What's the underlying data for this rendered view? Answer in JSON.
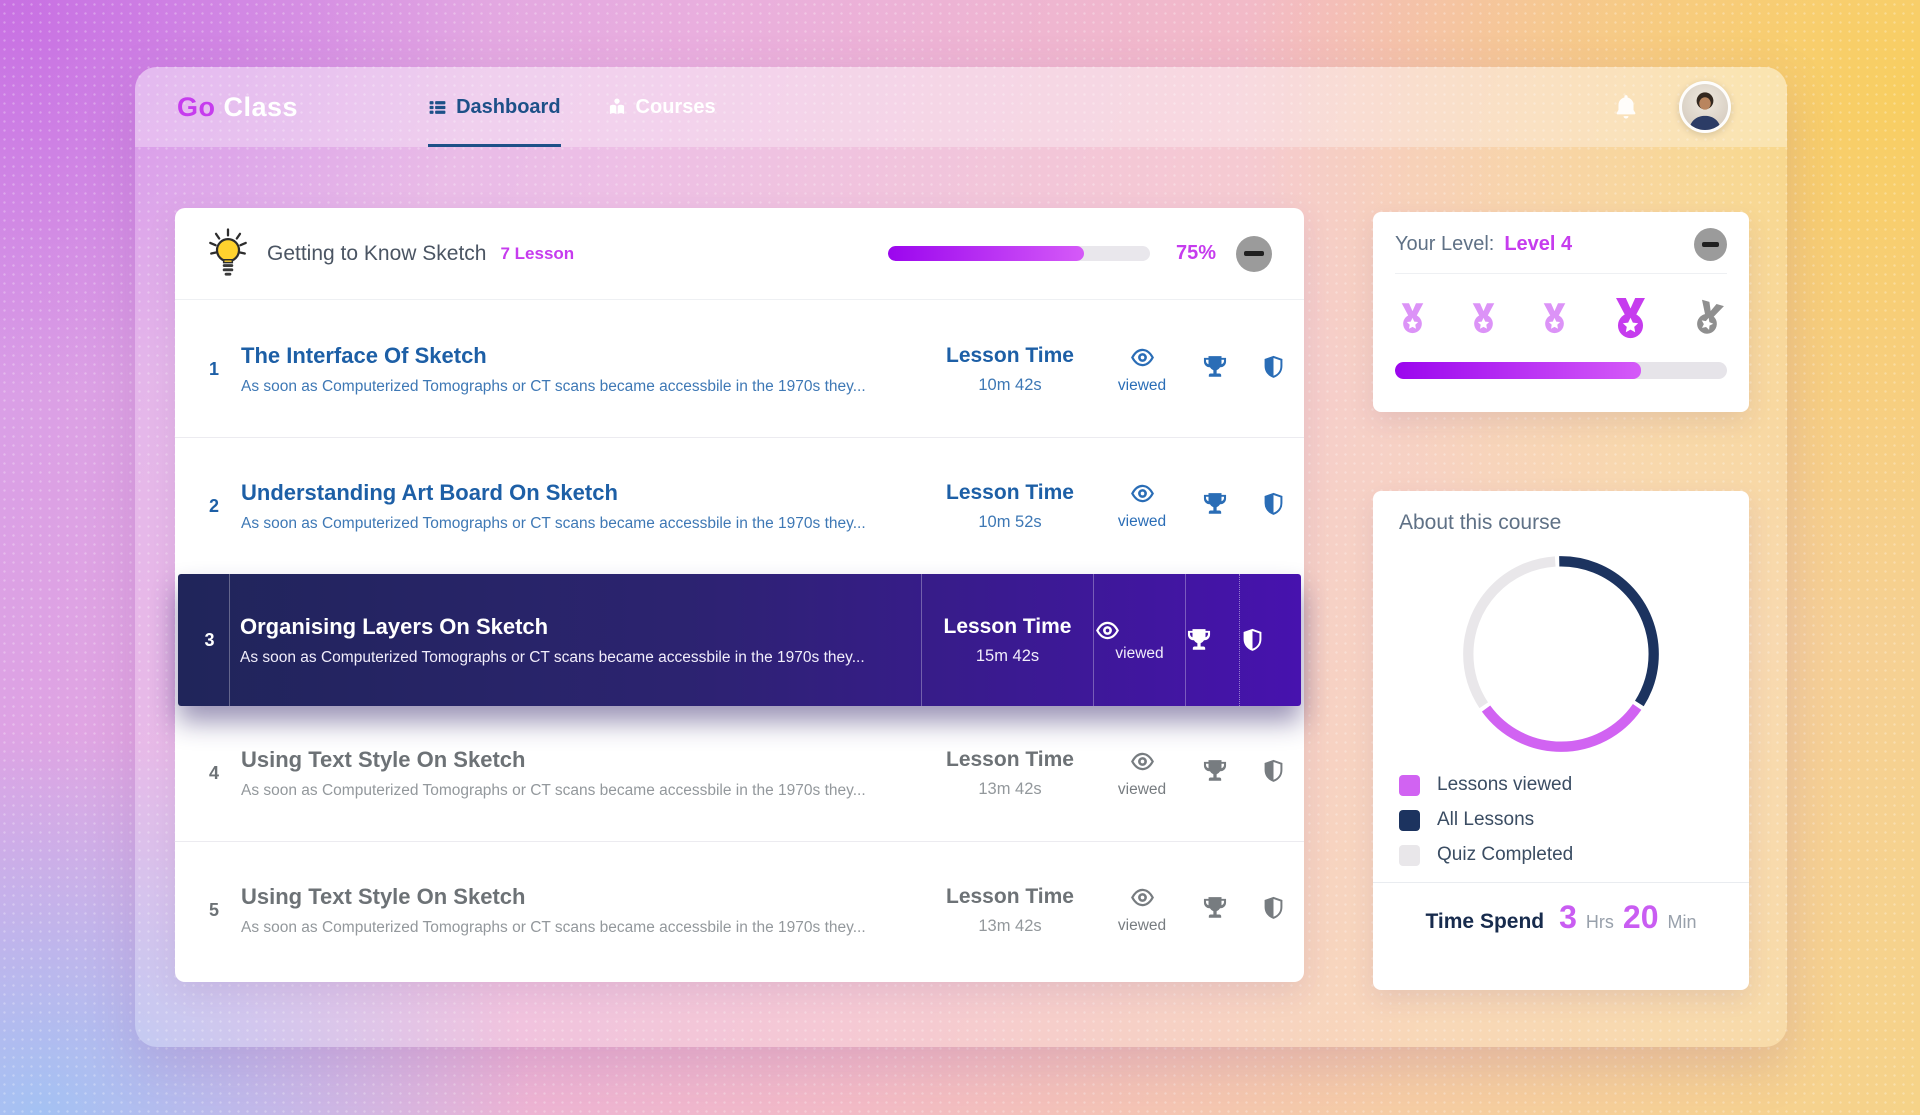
{
  "nav": {
    "logo_go": "Go",
    "logo_class": "Class",
    "tabs": [
      {
        "label": "Dashboard",
        "active": true
      },
      {
        "label": "Courses",
        "active": false
      }
    ]
  },
  "course_header": {
    "title": "Getting to Know Sketch",
    "lesson_count": "7 Lesson",
    "progress_value": 75,
    "progress_label": "75%"
  },
  "lessons": [
    {
      "num": "1",
      "title": "The Interface Of Sketch",
      "desc": "As soon as Computerized Tomographs or CT scans became accessbile in the 1970s they...",
      "time_label": "Lesson Time",
      "time": "10m 42s",
      "viewed_label": "viewed",
      "state": "viewed"
    },
    {
      "num": "2",
      "title": "Understanding Art Board On Sketch",
      "desc": "As soon as Computerized Tomographs or CT scans became accessbile in the 1970s they...",
      "time_label": "Lesson Time",
      "time": "10m 52s",
      "viewed_label": "viewed",
      "state": "viewed"
    },
    {
      "num": "3",
      "title": "Organising Layers On Sketch",
      "desc": "As soon as Computerized Tomographs or CT scans became accessbile in the 1970s they...",
      "time_label": "Lesson Time",
      "time": "15m 42s",
      "viewed_label": "viewed",
      "state": "active"
    },
    {
      "num": "4",
      "title": "Using Text Style On Sketch",
      "desc": "As soon as Computerized Tomographs or CT scans became accessbile in the 1970s they...",
      "time_label": "Lesson Time",
      "time": "13m 42s",
      "viewed_label": "viewed",
      "state": "pending"
    },
    {
      "num": "5",
      "title": "Using Text Style On Sketch",
      "desc": "As soon as Computerized Tomographs or CT scans became accessbile in the 1970s they...",
      "time_label": "Lesson Time",
      "time": "13m 42s",
      "viewed_label": "viewed",
      "state": "pending"
    }
  ],
  "level_card": {
    "label": "Your Level:",
    "level": "Level 4",
    "progress_value": 74,
    "medals": [
      {
        "state": "earned"
      },
      {
        "state": "earned"
      },
      {
        "state": "earned"
      },
      {
        "state": "current"
      },
      {
        "state": "locked"
      }
    ]
  },
  "about_card": {
    "title": "About this course",
    "legend": [
      {
        "label": "Lessons viewed",
        "color": "#d163f2"
      },
      {
        "label": "All Lessons",
        "color": "#1c335f"
      },
      {
        "label": "Quiz Completed",
        "color": "#e9e7ea"
      }
    ],
    "time_spend": {
      "label": "Time Spend",
      "hours": "3",
      "hours_unit": "Hrs",
      "minutes": "20",
      "minutes_unit": "Min"
    }
  },
  "chart_data": {
    "type": "pie",
    "subtype": "donut",
    "labels": [
      "All Lessons",
      "Lessons viewed",
      "Quiz Completed"
    ],
    "values": [
      35,
      31,
      34
    ],
    "colors": [
      "#1c335f",
      "#d163f2",
      "#e9e7ea"
    ],
    "title": "About this course",
    "legend_position": "bottom-left"
  },
  "colors": {
    "accent_magenta": "#c63cee",
    "nav_blue": "#1d5088",
    "lesson_blue": "#1d5fa6",
    "active_row_start": "#20255a",
    "active_row_end": "#4712ae"
  }
}
